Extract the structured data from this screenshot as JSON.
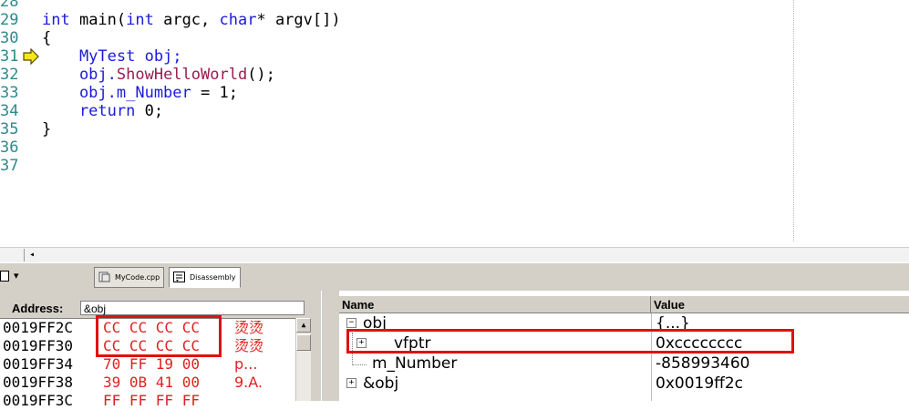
{
  "editor": {
    "line_numbers": [
      "28",
      "29",
      "30",
      "31",
      "32",
      "33",
      "34",
      "35",
      "36",
      "37"
    ],
    "lines": [
      {
        "parts": [
          {
            "t": "int",
            "k": "kw"
          },
          {
            "t": " main(",
            "k": ""
          },
          {
            "t": "int",
            "k": "kw"
          },
          {
            "t": " argc, ",
            "k": ""
          },
          {
            "t": "char",
            "k": "kw"
          },
          {
            "t": "* argv[])",
            "k": ""
          }
        ]
      },
      {
        "parts": [
          {
            "t": "{",
            "k": ""
          }
        ]
      },
      {
        "parts": [
          {
            "t": "    MyTest obj;",
            "k": "kw"
          }
        ]
      },
      {
        "parts": [
          {
            "t": "    obj.",
            "k": "kw"
          },
          {
            "t": "ShowHelloWorld",
            "k": "fn"
          },
          {
            "t": "();",
            "k": ""
          }
        ]
      },
      {
        "parts": [
          {
            "t": "    obj.m_Number",
            "k": "kw"
          },
          {
            "t": " = 1;",
            "k": ""
          }
        ]
      },
      {
        "parts": [
          {
            "t": "    return",
            "k": "kw"
          },
          {
            "t": " 0;",
            "k": ""
          }
        ]
      },
      {
        "parts": [
          {
            "t": "}",
            "k": ""
          }
        ]
      }
    ],
    "current_line_marker": "arrow-icon"
  },
  "tabs": [
    {
      "label": "MyCode.cpp",
      "icon": "source-file-icon"
    },
    {
      "label": "Disassembly",
      "icon": "disassembly-icon"
    }
  ],
  "memory": {
    "address_label": "Address:",
    "address_value": "&obj",
    "rows": [
      {
        "addr": "0019FF2C",
        "bytes": "CC CC CC CC",
        "chars": "烫烫"
      },
      {
        "addr": "0019FF30",
        "bytes": "CC CC CC CC",
        "chars": "烫烫"
      },
      {
        "addr": "0019FF34",
        "bytes": "70 FF 19 00",
        "chars": "p..."
      },
      {
        "addr": "0019FF38",
        "bytes": "39 0B 41 00",
        "chars": "9.A."
      },
      {
        "addr": "0019FF3C",
        "bytes": "FF FF FF FF",
        "chars": ""
      }
    ]
  },
  "watch": {
    "columns": {
      "name": "Name",
      "value": "Value"
    },
    "rows": [
      {
        "name": "obj",
        "value": "{...}",
        "expander": "−"
      },
      {
        "name": "vfptr",
        "value": "0xcccccccc",
        "expander": "+"
      },
      {
        "name": "m_Number",
        "value": "-858993460",
        "expander": ""
      },
      {
        "name": "&obj",
        "value": "0x0019ff2c",
        "expander": "+"
      }
    ]
  },
  "colors": {
    "keyword": "#1a1adb",
    "function": "#9b1b4f",
    "line_number": "#2b8a8a",
    "memory_changed": "#e02020",
    "highlight_box": "#e01010"
  }
}
